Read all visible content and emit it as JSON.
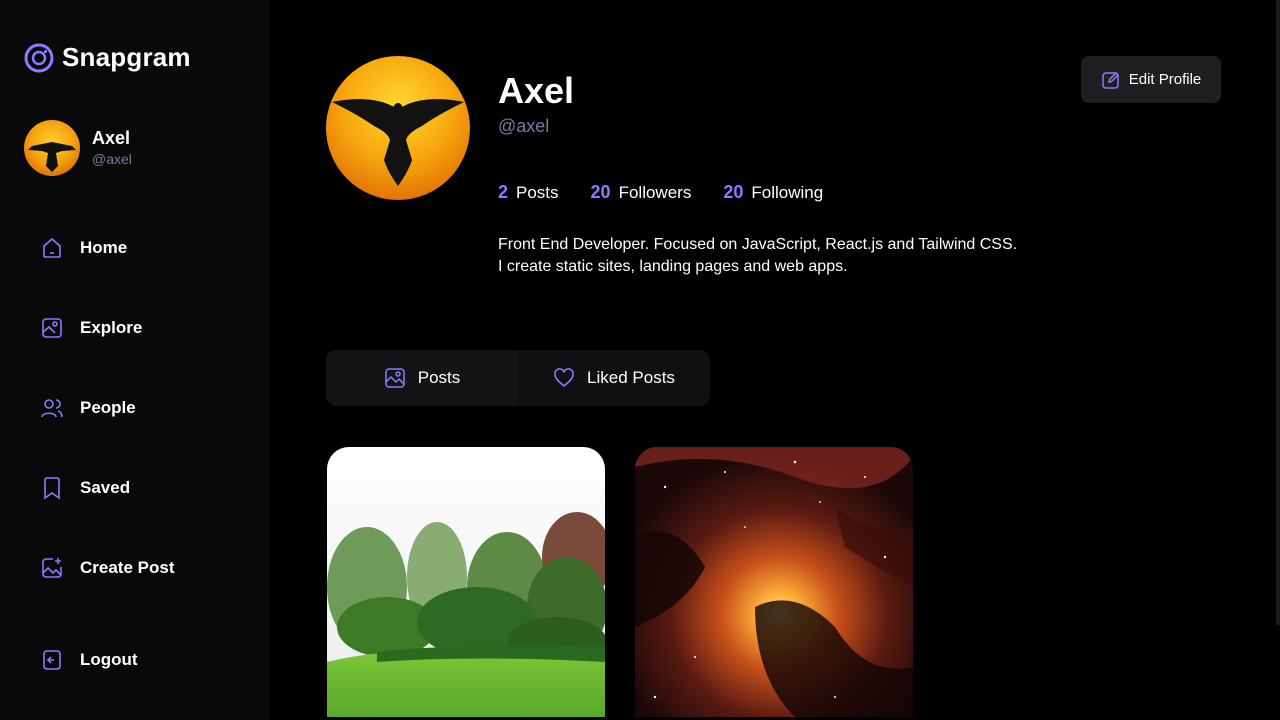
{
  "app": {
    "name": "Snapgram"
  },
  "colors": {
    "accent": "#877eff",
    "muted": "#7878a3",
    "sidebar": "#09090a",
    "background": "#000000"
  },
  "user": {
    "name": "Axel",
    "handle": "@axel"
  },
  "nav": {
    "home": "Home",
    "explore": "Explore",
    "people": "People",
    "saved": "Saved",
    "create": "Create Post",
    "logout": "Logout"
  },
  "profile": {
    "name": "Axel",
    "handle": "@axel",
    "stats": [
      {
        "value": "2",
        "label": "Posts"
      },
      {
        "value": "20",
        "label": "Followers"
      },
      {
        "value": "20",
        "label": "Following"
      }
    ],
    "bio_line1": "Front End Developer. Focused on JavaScript, React.js and Tailwind CSS.",
    "bio_line2": "I create static sites, landing pages and web apps.",
    "edit_label": "Edit Profile"
  },
  "tabs": [
    {
      "label": "Posts",
      "icon": "posts-icon",
      "active": true
    },
    {
      "label": "Liked Posts",
      "icon": "heart-icon",
      "active": false
    }
  ],
  "posts": [
    {
      "subject": "garden landscape"
    },
    {
      "subject": "nebula space"
    }
  ]
}
